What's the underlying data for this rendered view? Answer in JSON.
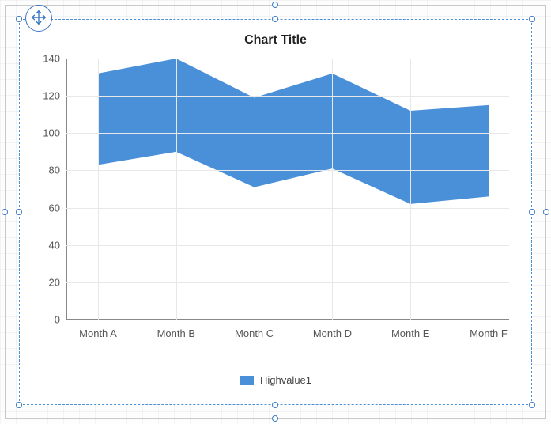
{
  "chart_data": {
    "type": "area",
    "subtype": "range-area",
    "title": "Chart Title",
    "categories": [
      "Month A",
      "Month B",
      "Month C",
      "Month D",
      "Month E",
      "Month F"
    ],
    "series": [
      {
        "name": "Highvalue1",
        "high": [
          132,
          140,
          119,
          132,
          112,
          115
        ],
        "low": [
          83,
          90,
          71,
          81,
          62,
          66
        ],
        "color": "#4a90d9"
      }
    ],
    "xlabel": "",
    "ylabel": "",
    "ylim": [
      0,
      140
    ],
    "yticks": [
      0,
      20,
      40,
      60,
      80,
      100,
      120,
      140
    ],
    "grid": true
  },
  "legend": {
    "label": "Highvalue1"
  }
}
